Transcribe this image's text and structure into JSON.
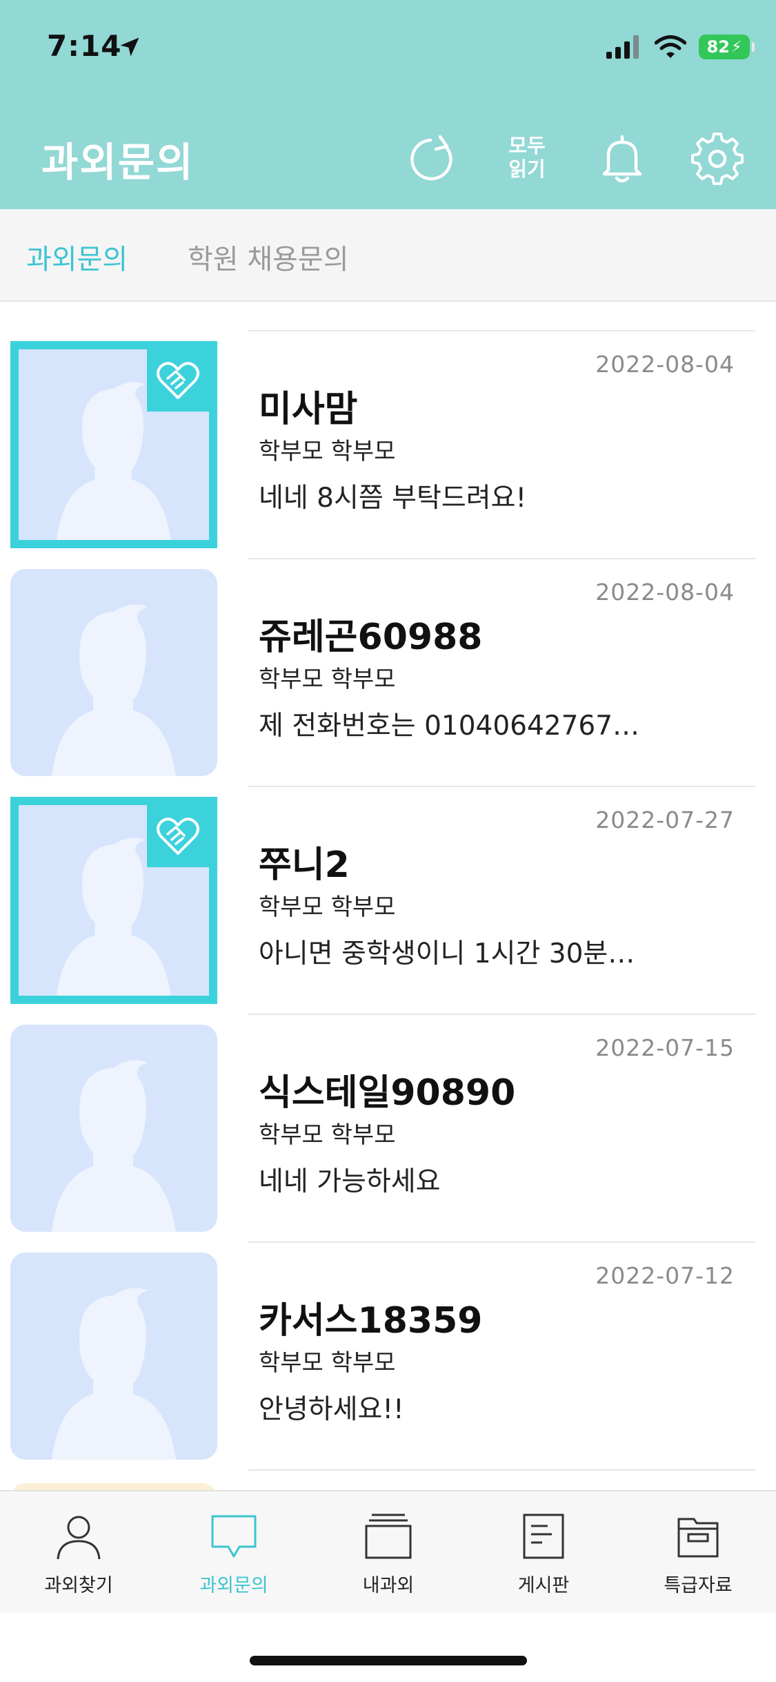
{
  "status_bar": {
    "time": "7:14",
    "battery": "82"
  },
  "header": {
    "title": "과외문의",
    "read_all_line1": "모두",
    "read_all_line2": "읽기"
  },
  "tabs": [
    {
      "label": "과외문의",
      "active": true
    },
    {
      "label": "학원 채용문의",
      "active": false
    }
  ],
  "messages": [
    {
      "name": "미사맘",
      "role": "학부모 학부모",
      "message": "네네 8시쯤 부탁드려요!",
      "date": "2022-08-04",
      "matched": true
    },
    {
      "name": "쥬레곤60988",
      "role": "학부모 학부모",
      "message": "제 전화번호는 01040642767…",
      "date": "2022-08-04",
      "matched": false
    },
    {
      "name": "쭈니2",
      "role": "학부모 학부모",
      "message": "아니면 중학생이니 1시간 30분…",
      "date": "2022-07-27",
      "matched": true
    },
    {
      "name": "식스테일90890",
      "role": "학부모 학부모",
      "message": "네네 가능하세요",
      "date": "2022-07-15",
      "matched": false
    },
    {
      "name": "카서스18359",
      "role": "학부모 학부모",
      "message": "안녕하세요!!",
      "date": "2022-07-12",
      "matched": false
    }
  ],
  "bottom_nav": [
    {
      "label": "과외찾기",
      "icon": "person-icon",
      "active": false
    },
    {
      "label": "과외문의",
      "icon": "chat-bubble-icon",
      "active": true
    },
    {
      "label": "내과외",
      "icon": "folder-stack-icon",
      "active": false
    },
    {
      "label": "게시판",
      "icon": "document-icon",
      "active": false
    },
    {
      "label": "특급자료",
      "icon": "archive-icon",
      "active": false
    }
  ],
  "colors": {
    "header": "#92d8d5",
    "accent": "#3cc4d2",
    "match_border": "#3cd2dc",
    "avatar_bg": "#d6e4fc"
  }
}
